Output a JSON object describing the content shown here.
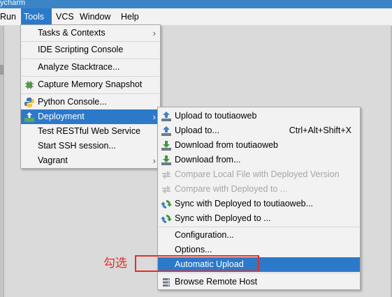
{
  "window": {
    "title": "ycharm"
  },
  "menubar": {
    "run": "Run",
    "tools": "Tools",
    "vcs": "VCS",
    "window": "Window",
    "help": "Help"
  },
  "tools_menu": {
    "tasks": "Tasks & Contexts",
    "ide_scripting": "IDE Scripting Console",
    "analyze_stacktrace": "Analyze Stacktrace...",
    "capture_memory": "Capture Memory Snapshot",
    "python_console": "Python Console...",
    "deployment": "Deployment",
    "test_restful": "Test RESTful Web Service",
    "start_ssh": "Start SSH session...",
    "vagrant": "Vagrant"
  },
  "deployment_menu": {
    "upload_to_server": "Upload to toutiaoweb",
    "upload_to": "Upload to...",
    "upload_to_shortcut": "Ctrl+Alt+Shift+X",
    "download_from_server": "Download from toutiaoweb",
    "download_from": "Download from...",
    "compare_local": "Compare Local File with Deployed Version",
    "compare_deployed": "Compare with Deployed to ...",
    "sync_server": "Sync with Deployed to toutiaoweb...",
    "sync_deployed": "Sync with Deployed to ...",
    "configuration": "Configuration...",
    "options": "Options...",
    "automatic_upload": "Automatic Upload",
    "browse_remote": "Browse Remote Host"
  },
  "annotation": {
    "text": "勾选",
    "color": "#e0302a"
  },
  "colors": {
    "selection": "#2c79c9",
    "menu_bg": "#f2f2f2",
    "disabled_text": "#a6a6a6"
  },
  "icons": [
    "upload-icon",
    "download-icon",
    "compare-icon",
    "sync-icon",
    "memory-chip-icon",
    "python-icon",
    "deployment-icon",
    "browse-remote-icon",
    "submenu-arrow-icon"
  ]
}
